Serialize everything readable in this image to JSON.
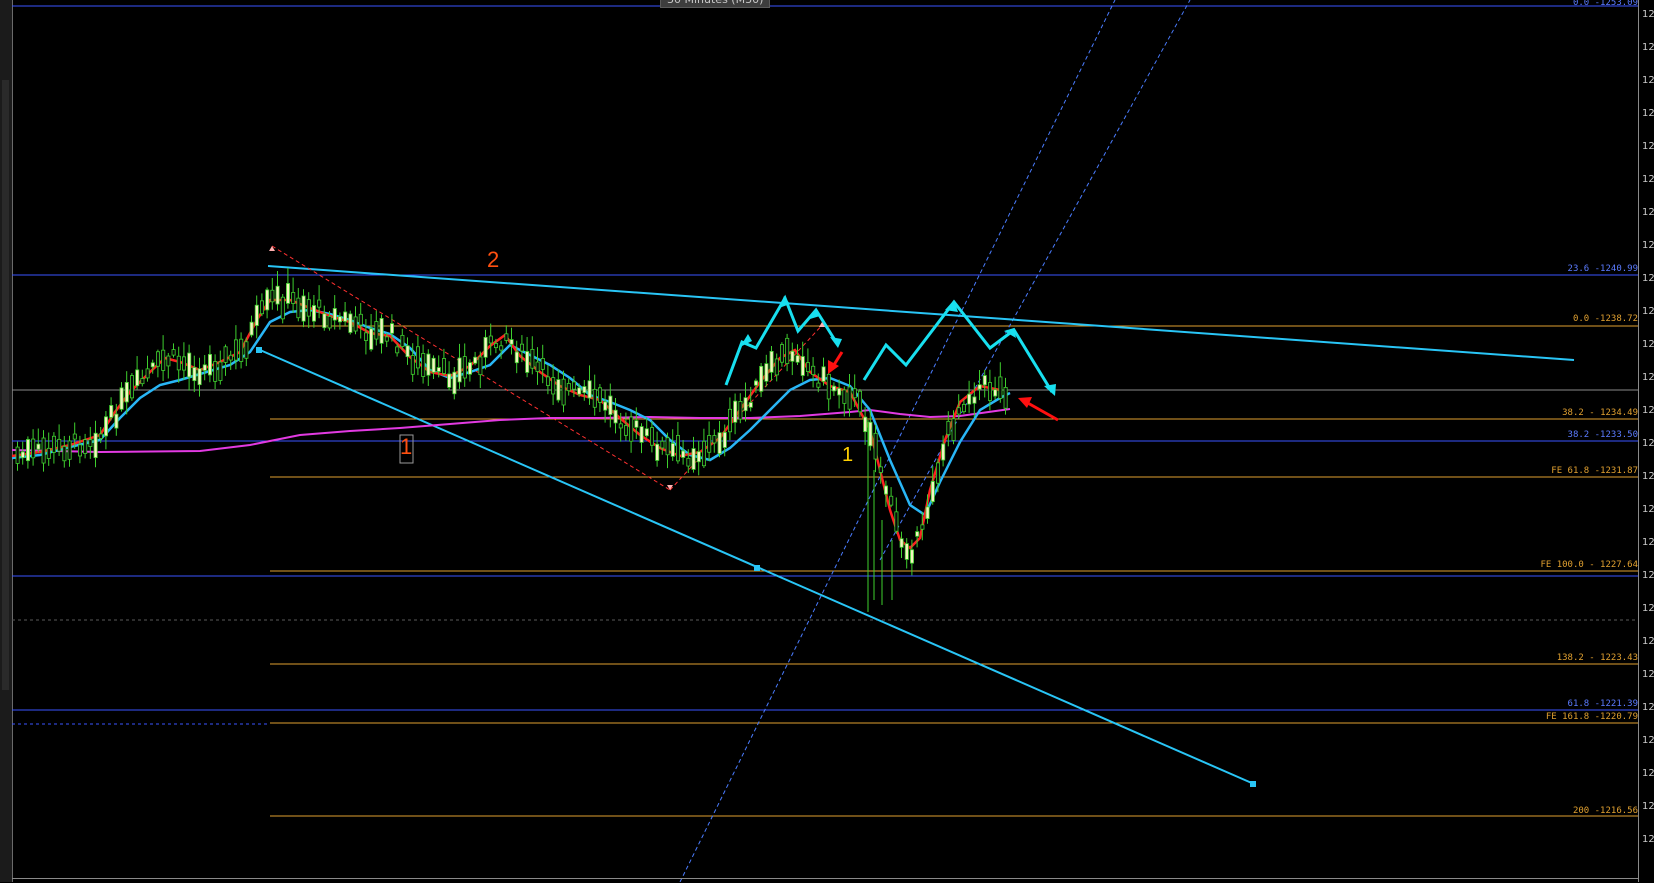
{
  "timeframe_label": "30 Minutes (M30)",
  "fib_levels": {
    "top": "0.0 -1253.09",
    "f236": "23.6 -1240.99",
    "f0": "0.0 -1238.72",
    "f382a": "38.2 - 1234.49",
    "f382b": "38.2 -1233.50",
    "fe618": "FE 61.8 -1231.87",
    "fe100": "FE 100.0 - 1227.64",
    "f1382": "138.2 - 1223.43",
    "f618": "61.8 -1221.39",
    "fe1618": "FE 161.8 -1220.79",
    "f200": "200 -1216.56"
  },
  "wave_labels": {
    "wave1_red": "1",
    "wave2_red": "2",
    "wave1_yellow": "1"
  },
  "price_scale_ticks": [
    "12",
    "12",
    "12",
    "12",
    "12",
    "12",
    "12",
    "12",
    "12",
    "12",
    "12",
    "12",
    "12",
    "12",
    "12",
    "12",
    "12",
    "12",
    "12",
    "12",
    "12",
    "12",
    "12",
    "12",
    "12",
    "12"
  ],
  "colors": {
    "background": "#000000",
    "candle_bull": "#f4f4c0",
    "candle_bear": "#0a0a0a",
    "wick": "#3ecf2e",
    "ema_fast": "#ff2020",
    "ema_mid": "#29b6f6",
    "sma_slow": "#e23ae2",
    "trendline": "#29c5f6",
    "fib_orange": "#e0a030",
    "fib_blue": "#3a55ff",
    "arrow_cyan": "#18e0f0",
    "arrow_red": "#ff1010"
  }
}
